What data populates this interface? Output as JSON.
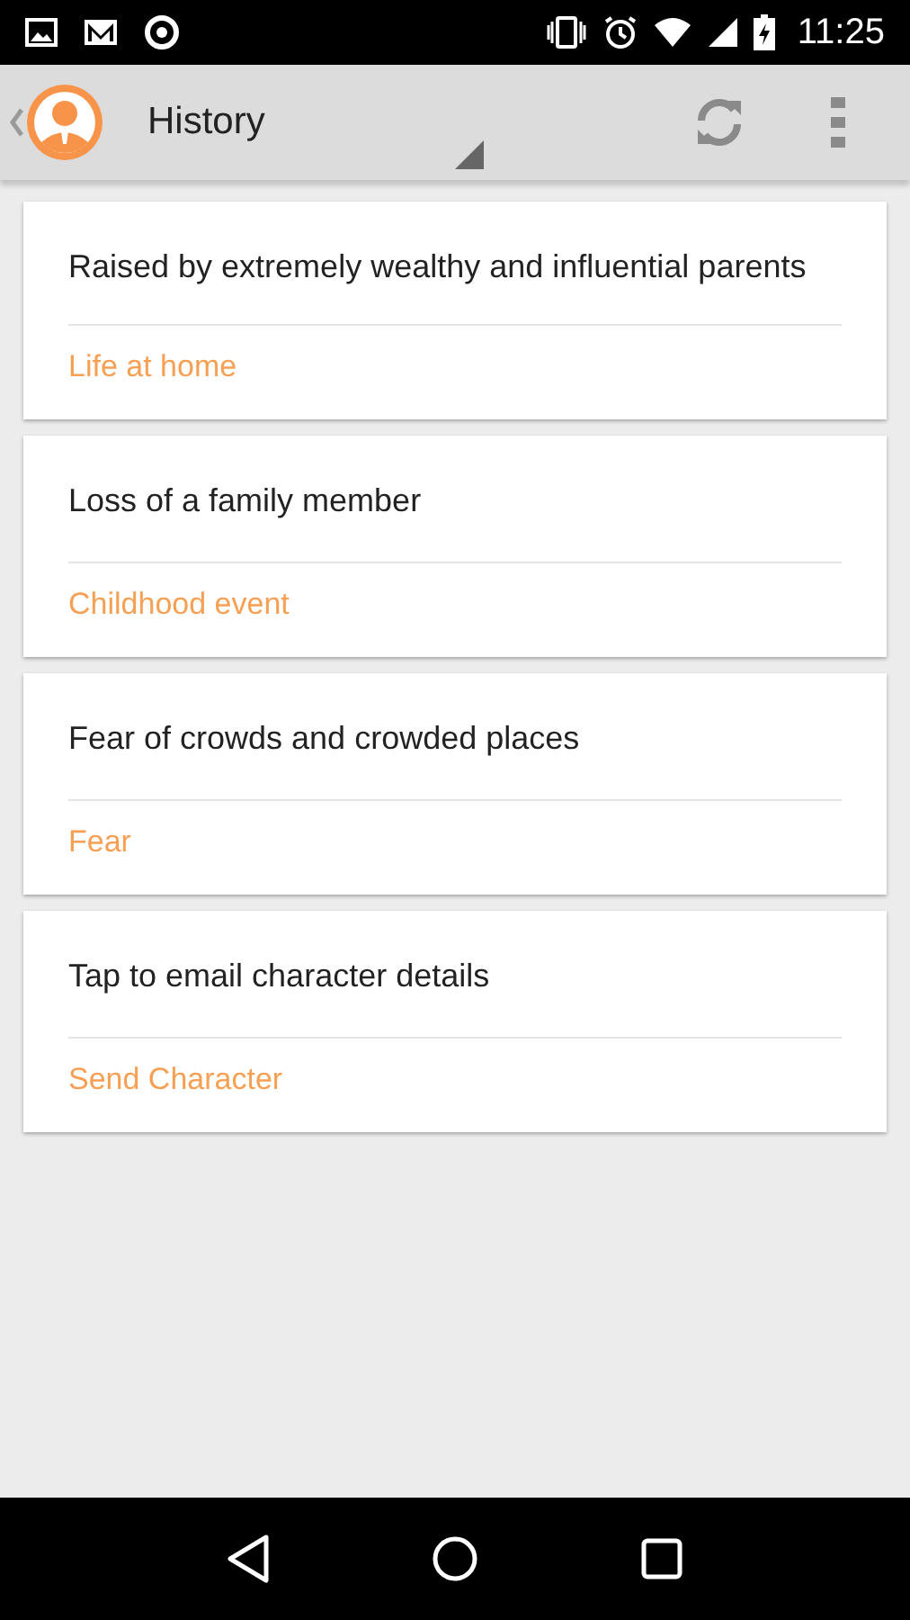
{
  "status_bar": {
    "time": "11:25"
  },
  "app_bar": {
    "title": "History"
  },
  "cards": [
    {
      "text": "Raised by extremely wealthy and influential parents",
      "category": "Life at home"
    },
    {
      "text": "Loss of a family member",
      "category": "Childhood event"
    },
    {
      "text": "Fear of crowds and crowded places",
      "category": "Fear"
    },
    {
      "text": "Tap to email character details",
      "category": "Send Character"
    }
  ]
}
